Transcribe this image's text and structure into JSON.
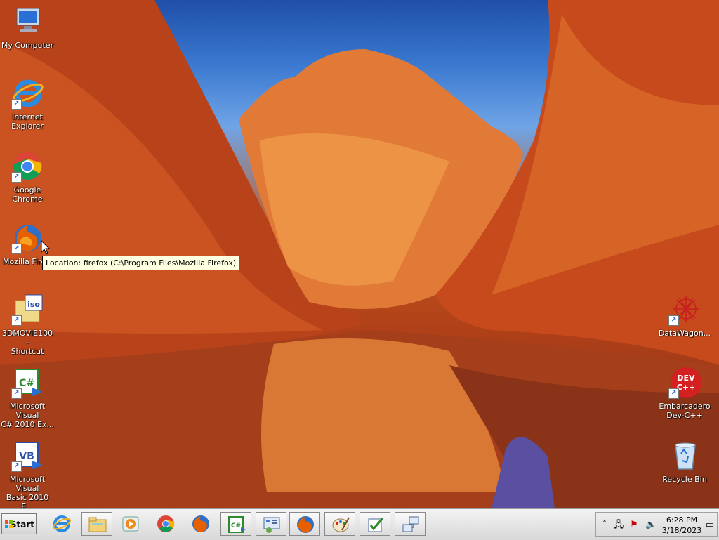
{
  "desktop_icons": [
    {
      "name": "icon-my-computer",
      "label": "My Computer",
      "icon": "computer-icon"
    },
    {
      "name": "icon-internet-explorer",
      "label": "Internet Explorer",
      "icon": "internet-explorer-icon"
    },
    {
      "name": "icon-google-chrome",
      "label": "Google Chrome",
      "icon": "chrome-icon"
    },
    {
      "name": "icon-mozilla-firefox",
      "label": "Mozilla Firefox",
      "icon": "firefox-icon"
    },
    {
      "name": "icon-3dmovie100",
      "label": "3DMOVIE100 - Shortcut",
      "icon": "iso-file-icon"
    },
    {
      "name": "icon-visual-csharp",
      "label": "Microsoft Visual C# 2010 Ex...",
      "icon": "visual-csharp-icon"
    },
    {
      "name": "icon-visual-basic",
      "label": "Microsoft Visual Basic 2010 E...",
      "icon": "visual-basic-icon"
    },
    {
      "name": "icon-datawagon",
      "label": "DataWagon...",
      "icon": "datawagon-icon"
    },
    {
      "name": "icon-devcpp",
      "label": "Embarcadero Dev-C++",
      "icon": "devcpp-icon"
    },
    {
      "name": "icon-recycle-bin",
      "label": "Recycle Bin",
      "icon": "recycle-bin-icon"
    }
  ],
  "visible_labels": {
    "my_computer": "My Computer",
    "internet_explorer": "Internet\nExplorer",
    "google_chrome": "Google Chrome",
    "mozilla_firefox": "Mozilla Firef",
    "movie": "3DMOVIE100 -\nShortcut",
    "csharp": "Microsoft Visual\nC# 2010 Ex...",
    "vbasic": "Microsoft Visual\nBasic 2010 E...",
    "datawagon": "DataWagon...",
    "devcpp": "Embarcadero\nDev-C++",
    "recycle_bin": "Recycle Bin"
  },
  "icon_glyphs": {
    "iso": "iso",
    "csharp": "C#",
    "vb": "VB",
    "dev": "DEV",
    "devpp": "C++"
  },
  "tooltip": "Location: firefox (C:\\Program Files\\Mozilla Firefox)",
  "taskbar": {
    "start_label": "Start",
    "buttons": [
      {
        "name": "taskbar-internet-explorer",
        "icon": "internet-explorer-icon"
      },
      {
        "name": "taskbar-windows-explorer",
        "icon": "folder-icon"
      },
      {
        "name": "taskbar-media-player",
        "icon": "media-player-icon"
      },
      {
        "name": "taskbar-chrome",
        "icon": "chrome-icon"
      },
      {
        "name": "taskbar-firefox",
        "icon": "firefox-icon"
      },
      {
        "name": "taskbar-visual-csharp",
        "icon": "visual-csharp-icon"
      },
      {
        "name": "taskbar-control-panel",
        "icon": "control-panel-icon"
      },
      {
        "name": "taskbar-firefox-window",
        "icon": "firefox-icon"
      },
      {
        "name": "taskbar-paint",
        "icon": "paint-icon"
      },
      {
        "name": "taskbar-task-app",
        "icon": "checklist-icon"
      },
      {
        "name": "taskbar-network-app",
        "icon": "network-icon"
      }
    ],
    "tray": {
      "time": "6:28 PM",
      "date": "3/18/2023",
      "icons": [
        "show-hidden-icons-icon",
        "network-tray-icon",
        "action-center-icon",
        "volume-icon",
        "show-desktop-icon"
      ]
    }
  },
  "colors": {
    "tooltip_bg": "#ffffe1",
    "taskbar_bg": "#dcdcdc"
  }
}
